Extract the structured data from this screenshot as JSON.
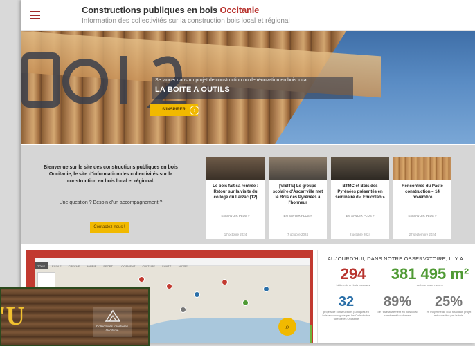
{
  "header": {
    "title_main": "Constructions publiques en bois ",
    "title_accent": "Occitanie",
    "subtitle": "Information des collectivités sur la construction bois local et régional"
  },
  "hero": {
    "kicker": "Se lancer dans un projet de construction ou de rénovation en bois local",
    "title": "LA BOITE A OUTILS",
    "button": "S'INSPIRER"
  },
  "welcome": {
    "text": "Bienvenue sur le site des constructions publiques en bois Occitanie, le site d'information des collectivités sur la construction en bois local et régional.",
    "question": "Une question ? Besoin d'un accompagnement ?",
    "contact_button": "Contactez-nous !"
  },
  "cards": [
    {
      "title": "Le bois fait sa rentrée : Retour sur la visite du collège du Larzac (12)",
      "more": "EN SAVOIR PLUS »",
      "date": "17 octobre 2024"
    },
    {
      "title": "[VISITE] Le groupe scolaire d'Ascarrville met le Bois des Pyrénées à l'honneur",
      "more": "EN SAVOIR PLUS »",
      "date": "7 octobre 2024"
    },
    {
      "title": "BTMC et Bois des Pyrénées présentés en séminaire d'« Emicolab »",
      "more": "EN SAVOIR PLUS »",
      "date": "2 octobre 2024"
    },
    {
      "title": "Rencontres du Pacte construction – 14 novembre",
      "more": "EN SAVOIR PLUS »",
      "date": "27 septembre 2024"
    }
  ],
  "map": {
    "tabs": [
      "TOUS",
      "ÉCOLE",
      "CRÈCHE",
      "MAIRIE",
      "SPORT",
      "LOGEMENT",
      "CULTURE",
      "SANTÉ",
      "AUTRE"
    ]
  },
  "stats": {
    "title": "AUJOURD'HUI, DANS NOTRE OBSERVATOIRE, IL Y A :",
    "items": [
      {
        "value": "294",
        "label": "bâtiments en bois recensés",
        "color": "#b8332e"
      },
      {
        "value": "381 495 m²",
        "label": "de bois mis en œuvre",
        "color": "#4f9a34"
      },
      {
        "value": "32",
        "label": "projets de constructions publiques en bois accompagnés par les Collectivités forestières Occitanie",
        "color": "#2a6fa8"
      },
      {
        "value": "89%",
        "label": "de l'investissement en bois local transformé localement",
        "color": "#777777"
      },
      {
        "value": "25%",
        "label": "en moyenne du coût total d'un projet est constitué par le bois",
        "color": "#777777"
      }
    ]
  },
  "inset": {
    "text": "'U",
    "logo_caption": "Collectivités forestières Occitanie"
  }
}
